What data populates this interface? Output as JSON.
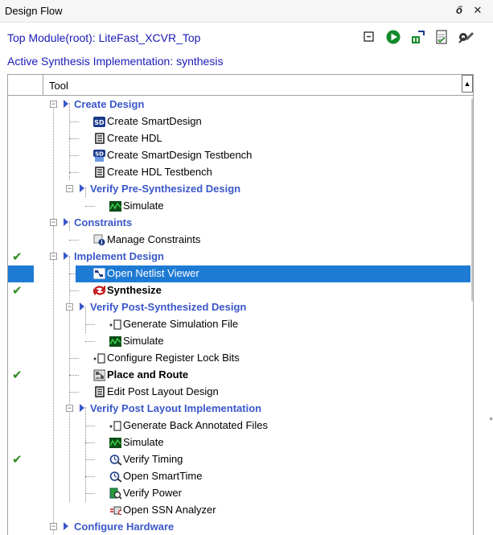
{
  "window": {
    "title": "Design Flow",
    "float_glyph": "ő",
    "close_glyph": "✕"
  },
  "info": {
    "top_module": "Top Module(root): LiteFast_XCVR_Top",
    "active_impl": "Active Synthesis Implementation: synthesis"
  },
  "toolbar": {
    "icons": [
      "collapse-all-icon",
      "run-icon",
      "update-icon",
      "report-icon",
      "settings-icon"
    ]
  },
  "tree": {
    "column_header": "Tool",
    "rows": [
      {
        "label": "Create Design"
      },
      {
        "label": "Create SmartDesign"
      },
      {
        "label": "Create HDL"
      },
      {
        "label": "Create SmartDesign Testbench"
      },
      {
        "label": "Create HDL Testbench"
      },
      {
        "label": "Verify Pre-Synthesized Design"
      },
      {
        "label": "Simulate"
      },
      {
        "label": "Constraints"
      },
      {
        "label": "Manage Constraints"
      },
      {
        "label": "Implement Design"
      },
      {
        "label": "Open Netlist Viewer"
      },
      {
        "label": "Synthesize"
      },
      {
        "label": "Verify Post-Synthesized Design"
      },
      {
        "label": "Generate Simulation File"
      },
      {
        "label": "Simulate"
      },
      {
        "label": "Configure Register Lock Bits"
      },
      {
        "label": "Place and Route"
      },
      {
        "label": "Edit Post Layout Design"
      },
      {
        "label": "Verify Post Layout Implementation"
      },
      {
        "label": "Generate Back Annotated Files"
      },
      {
        "label": "Simulate"
      },
      {
        "label": "Verify Timing"
      },
      {
        "label": "Open SmartTime"
      },
      {
        "label": "Verify Power"
      },
      {
        "label": "Open SSN Analyzer"
      },
      {
        "label": "Configure Hardware"
      }
    ]
  },
  "colors": {
    "group_text": "#3a57c9",
    "selection": "#1e7bd4",
    "check": "#2e8b1e",
    "info_text": "#1a1ab8"
  }
}
